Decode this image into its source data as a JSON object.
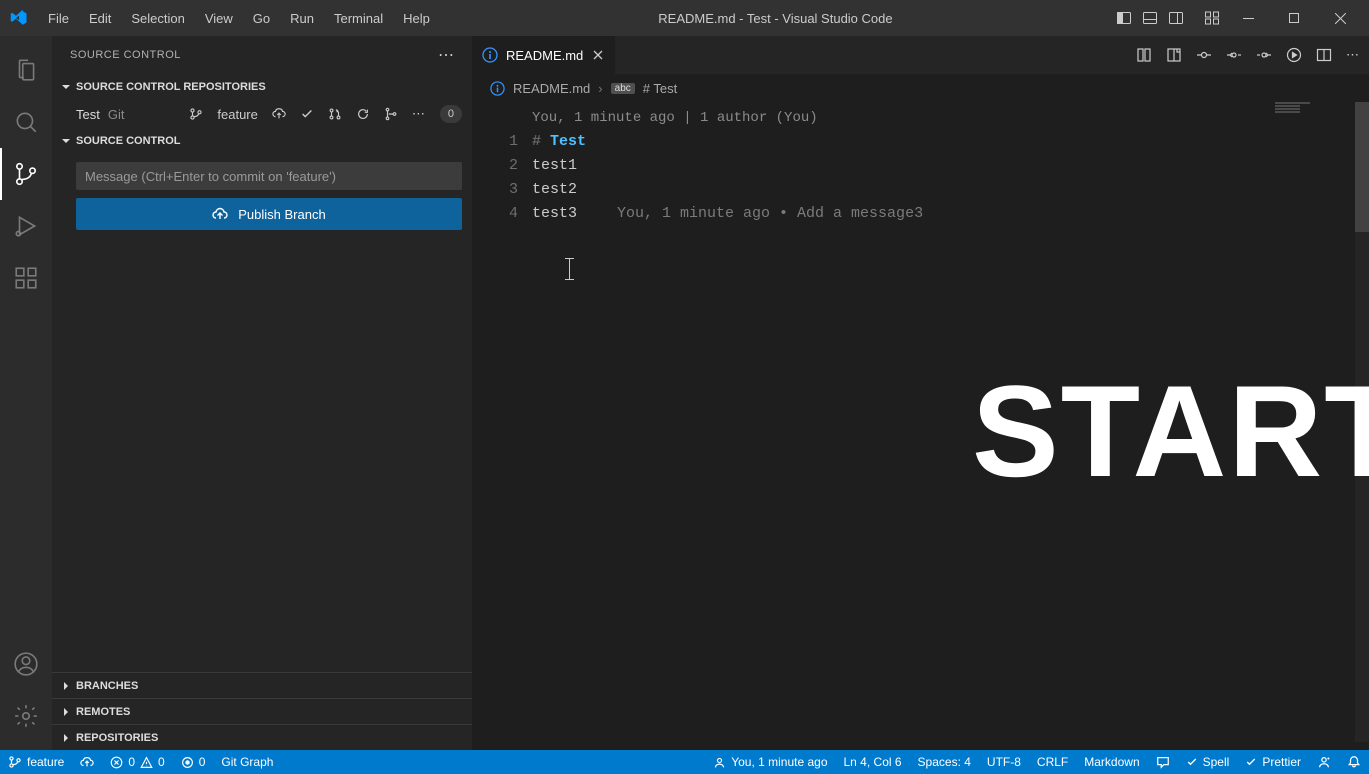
{
  "titlebar": {
    "menu": [
      "File",
      "Edit",
      "Selection",
      "View",
      "Go",
      "Run",
      "Terminal",
      "Help"
    ],
    "title": "README.md - Test - Visual Studio Code"
  },
  "sidebar": {
    "title": "SOURCE CONTROL",
    "sections": {
      "repos": "SOURCE CONTROL REPOSITORIES",
      "scm": "SOURCE CONTROL",
      "branches": "BRANCHES",
      "remotes": "REMOTES",
      "repositories": "REPOSITORIES"
    },
    "repo": {
      "name": "Test",
      "type": "Git",
      "branch": "feature",
      "badge": "0"
    },
    "commit_placeholder": "Message (Ctrl+Enter to commit on 'feature')",
    "publish_btn": "Publish Branch"
  },
  "tabs": {
    "active": "README.md"
  },
  "breadcrumb": {
    "file": "README.md",
    "symbol": "# Test",
    "badge": "abc"
  },
  "editor": {
    "blame_header": "You, 1 minute ago | 1 author (You)",
    "lines": {
      "1": {
        "num": "1",
        "hash": "#",
        "title": "Test"
      },
      "2": {
        "num": "2",
        "text": "test1"
      },
      "3": {
        "num": "3",
        "text": "test2"
      },
      "4": {
        "num": "4",
        "text": "test3",
        "blame": "You, 1 minute ago • Add a message3"
      }
    }
  },
  "overlay": "START",
  "statusbar": {
    "branch": "feature",
    "errors": "0",
    "warnings": "0",
    "ports": "0",
    "gitgraph": "Git Graph",
    "blame": "You, 1 minute ago",
    "position": "Ln 4, Col 6",
    "spaces": "Spaces: 4",
    "encoding": "UTF-8",
    "eol": "CRLF",
    "language": "Markdown",
    "spell": "Spell",
    "prettier": "Prettier"
  }
}
